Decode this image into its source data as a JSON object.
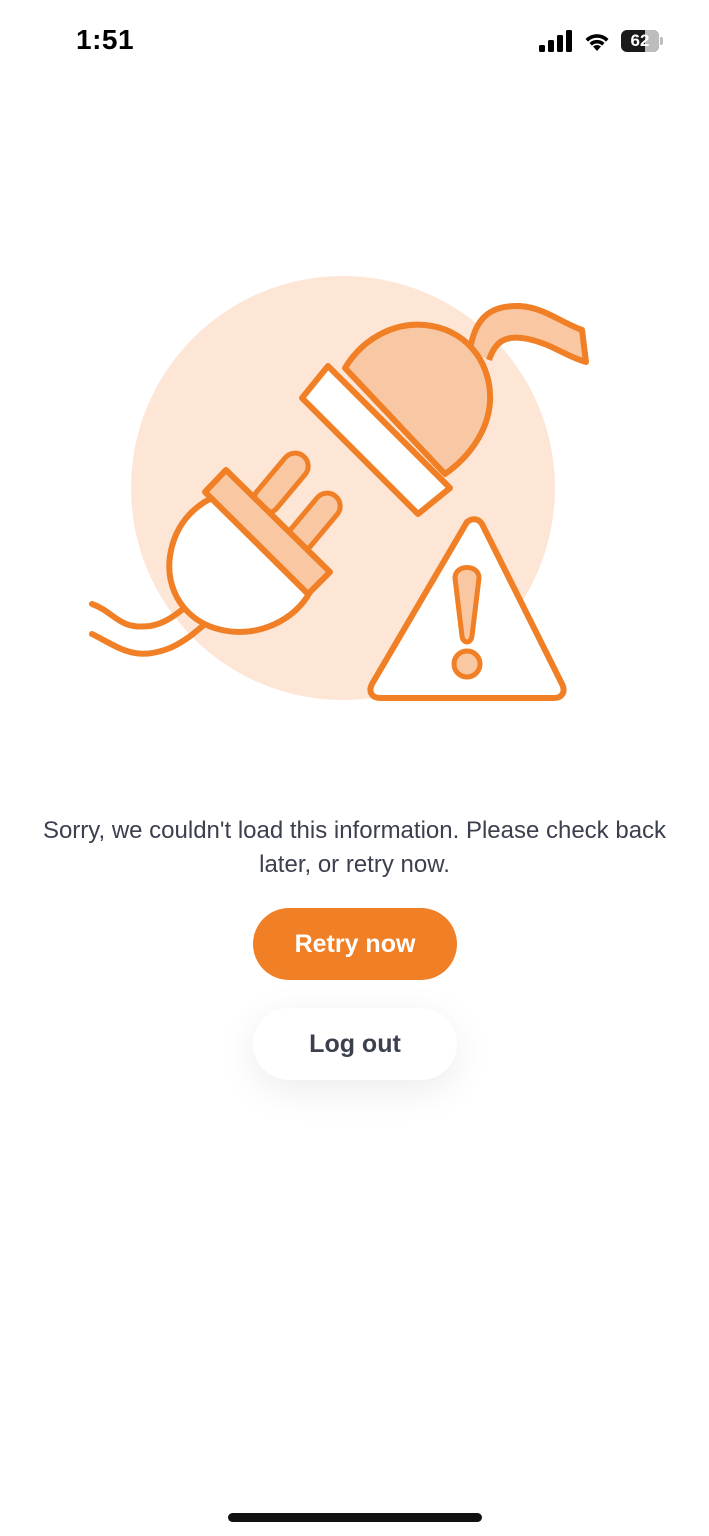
{
  "status_bar": {
    "time": "1:51",
    "battery_level": "62",
    "battery_fraction": 0.62,
    "icons": [
      "signal-icon",
      "wifi-icon",
      "battery-icon"
    ]
  },
  "illustration": {
    "icons": [
      "unplugged-plug-icon",
      "socket-icon",
      "warning-icon"
    ],
    "colors": {
      "accent": "#f07f25",
      "circle_bg": "#fde6d6",
      "socket_fill": "#f8c8a4",
      "stroke_light": "#f9c8a2"
    }
  },
  "error": {
    "message": "Sorry, we couldn't load this information. Please check back later, or retry now."
  },
  "actions": {
    "retry_label": "Retry now",
    "logout_label": "Log out"
  },
  "colors": {
    "primary": "#f07f25",
    "text": "#3c3f4e",
    "background": "#ffffff"
  }
}
